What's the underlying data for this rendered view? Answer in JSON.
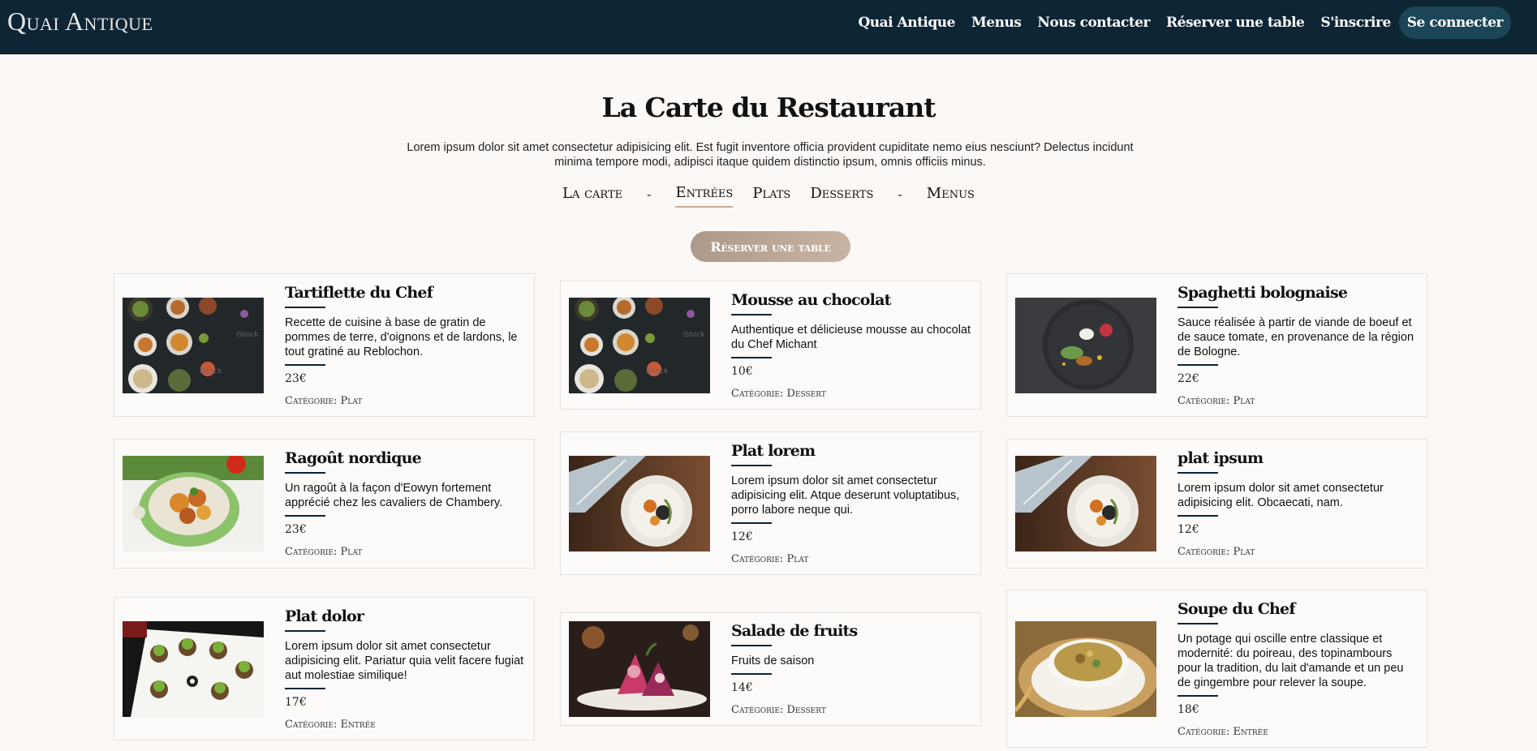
{
  "brand": "Quai Antique",
  "nav": [
    "Quai Antique",
    "Menus",
    "Nous contacter",
    "Réserver une table",
    "S'inscrire",
    "Se connecter"
  ],
  "title": "La Carte du Restaurant",
  "intro": "Lorem ipsum dolor sit amet consectetur adipisicing elit. Est fugit inventore officia provident cupiditate nemo eius nesciunt? Delectus incidunt minima tempore modi, adipisci itaque quidem distinctio ipsum, omnis officiis minus.",
  "filters": {
    "carte": "La carte",
    "sep1": "-",
    "entrees": "Entrées",
    "plats": "Plats",
    "desserts": "Desserts",
    "sep2": "-",
    "menus": "Menus"
  },
  "reserve": "Réserver une table",
  "dishes": [
    {
      "name": "Tartiflette du Chef",
      "desc": "Recette de cuisine à base de gratin de pommes de terre, d'oignons et de lardons, le tout gratiné au Reblochon.",
      "price": "23€",
      "category": "Catégorie: Plat",
      "image": "platter"
    },
    {
      "name": "Mousse au chocolat",
      "desc": "Authentique et délicieuse mousse au chocolat du Chef Michant",
      "price": "10€",
      "category": "Catégorie: Dessert",
      "image": "platter"
    },
    {
      "name": "Spaghetti bolognaise",
      "desc": "Sauce réalisée à partir de viande de boeuf et de sauce tomate, en provenance de la région de Bologne.",
      "price": "22€",
      "category": "Catégorie: Plat",
      "image": "dark-plate"
    },
    {
      "name": "Ragoût nordique",
      "desc": "Un ragoût à la façon d'Eowyn fortement apprécié chez les cavaliers de Chambery.",
      "price": "23€",
      "category": "Catégorie: Plat",
      "image": "stew"
    },
    {
      "name": "Plat lorem",
      "desc": "Lorem ipsum dolor sit amet consectetur adipisicing elit. Atque deserunt voluptatibus, porro labore neque qui.",
      "price": "12€",
      "category": "Catégorie: Plat",
      "image": "wood-plate"
    },
    {
      "name": "plat ipsum",
      "desc": "Lorem ipsum dolor sit amet consectetur adipisicing elit. Obcaecati, nam.",
      "price": "12€",
      "category": "Catégorie: Plat",
      "image": "wood-plate"
    },
    {
      "name": "Plat dolor",
      "desc": "Lorem ipsum dolor sit amet consectetur adipisicing elit. Pariatur quia velit facere fugiat aut molestiae similique!",
      "price": "17€",
      "category": "Catégorie: Entrée",
      "image": "sushi"
    },
    {
      "name": "Salade de fruits",
      "desc": "Fruits de saison",
      "price": "14€",
      "category": "Catégorie: Dessert",
      "image": "fruit"
    },
    {
      "name": "Soupe du Chef",
      "desc": "Un potage qui oscille entre classique et modernité: du poireau, des topinambours pour la tradition, du lait d'amande et un peu de gingembre pour relever la soupe.",
      "price": "18€",
      "category": "Catégorie: Entrée",
      "image": "soup"
    }
  ]
}
